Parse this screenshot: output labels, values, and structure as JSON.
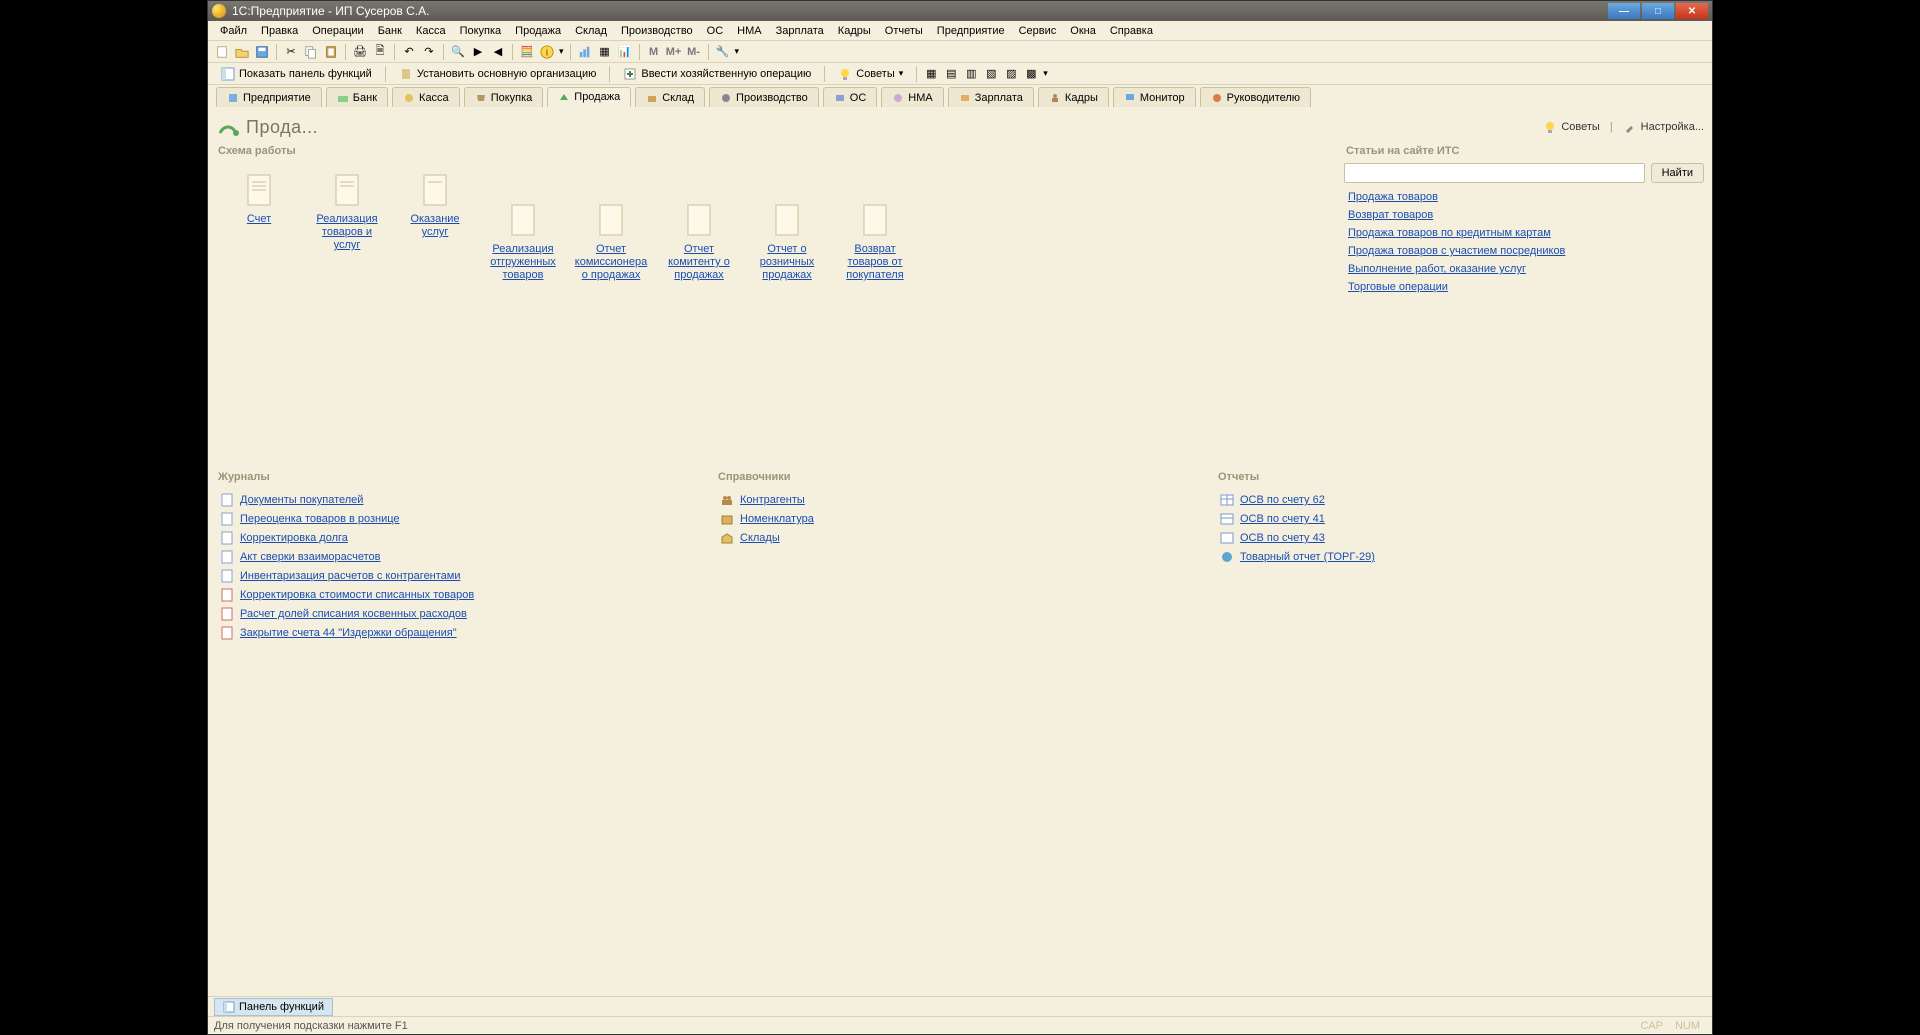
{
  "window": {
    "title": "1С:Предприятие - ИП Сусеров С.А."
  },
  "menu": [
    "Файл",
    "Правка",
    "Операции",
    "Банк",
    "Касса",
    "Покупка",
    "Продажа",
    "Склад",
    "Производство",
    "ОС",
    "НМА",
    "Зарплата",
    "Кадры",
    "Отчеты",
    "Предприятие",
    "Сервис",
    "Окна",
    "Справка"
  ],
  "toolbar2": {
    "show_panel": "Показать панель функций",
    "set_org": "Установить основную организацию",
    "enter_op": "Ввести хозяйственную операцию",
    "tips": "Советы"
  },
  "tabs": [
    "Предприятие",
    "Банк",
    "Касса",
    "Покупка",
    "Продажа",
    "Склад",
    "Производство",
    "ОС",
    "НМА",
    "Зарплата",
    "Кадры",
    "Монитор",
    "Руководителю"
  ],
  "active_tab": 4,
  "page": {
    "title": "Прода...",
    "tips": "Советы",
    "settings": "Настройка..."
  },
  "scheme": {
    "title": "Схема работы",
    "row1": [
      "Счет",
      "Реализация товаров и услуг",
      "Оказание услуг"
    ],
    "row2": [
      "Реализация отгруженных товаров",
      "Отчет комиссионера о продажах",
      "Отчет комитенту о продажах",
      "Отчет о розничных продажах",
      "Возврат товаров от покупателя"
    ]
  },
  "its": {
    "title": "Статьи на сайте ИТС",
    "find": "Найти",
    "links": [
      "Продажа товаров",
      "Возврат товаров",
      "Продажа товаров по кредитным картам",
      "Продажа товаров с участием посредников",
      "Выполнение работ, оказание услуг",
      "Торговые операции"
    ]
  },
  "journals": {
    "title": "Журналы",
    "items": [
      "Документы покупателей",
      "Переоценка товаров в рознице",
      "Корректировка долга",
      "Акт сверки взаиморасчетов",
      "Инвентаризация расчетов с контрагентами",
      "Корректировка стоимости списанных товаров",
      "Расчет долей списания косвенных расходов",
      "Закрытие счета 44 \"Издержки обращения\""
    ]
  },
  "refs": {
    "title": "Справочники",
    "items": [
      "Контрагенты",
      "Номенклатура",
      "Склады"
    ]
  },
  "reports": {
    "title": "Отчеты",
    "items": [
      "ОСВ по счету 62",
      "ОСВ по счету 41",
      "ОСВ по счету 43",
      "Товарный отчет (ТОРГ-29)"
    ]
  },
  "bottombar": {
    "tab": "Панель функций"
  },
  "status": {
    "hint": "Для получения подсказки нажмите F1",
    "cap": "CAP",
    "num": "NUM"
  }
}
